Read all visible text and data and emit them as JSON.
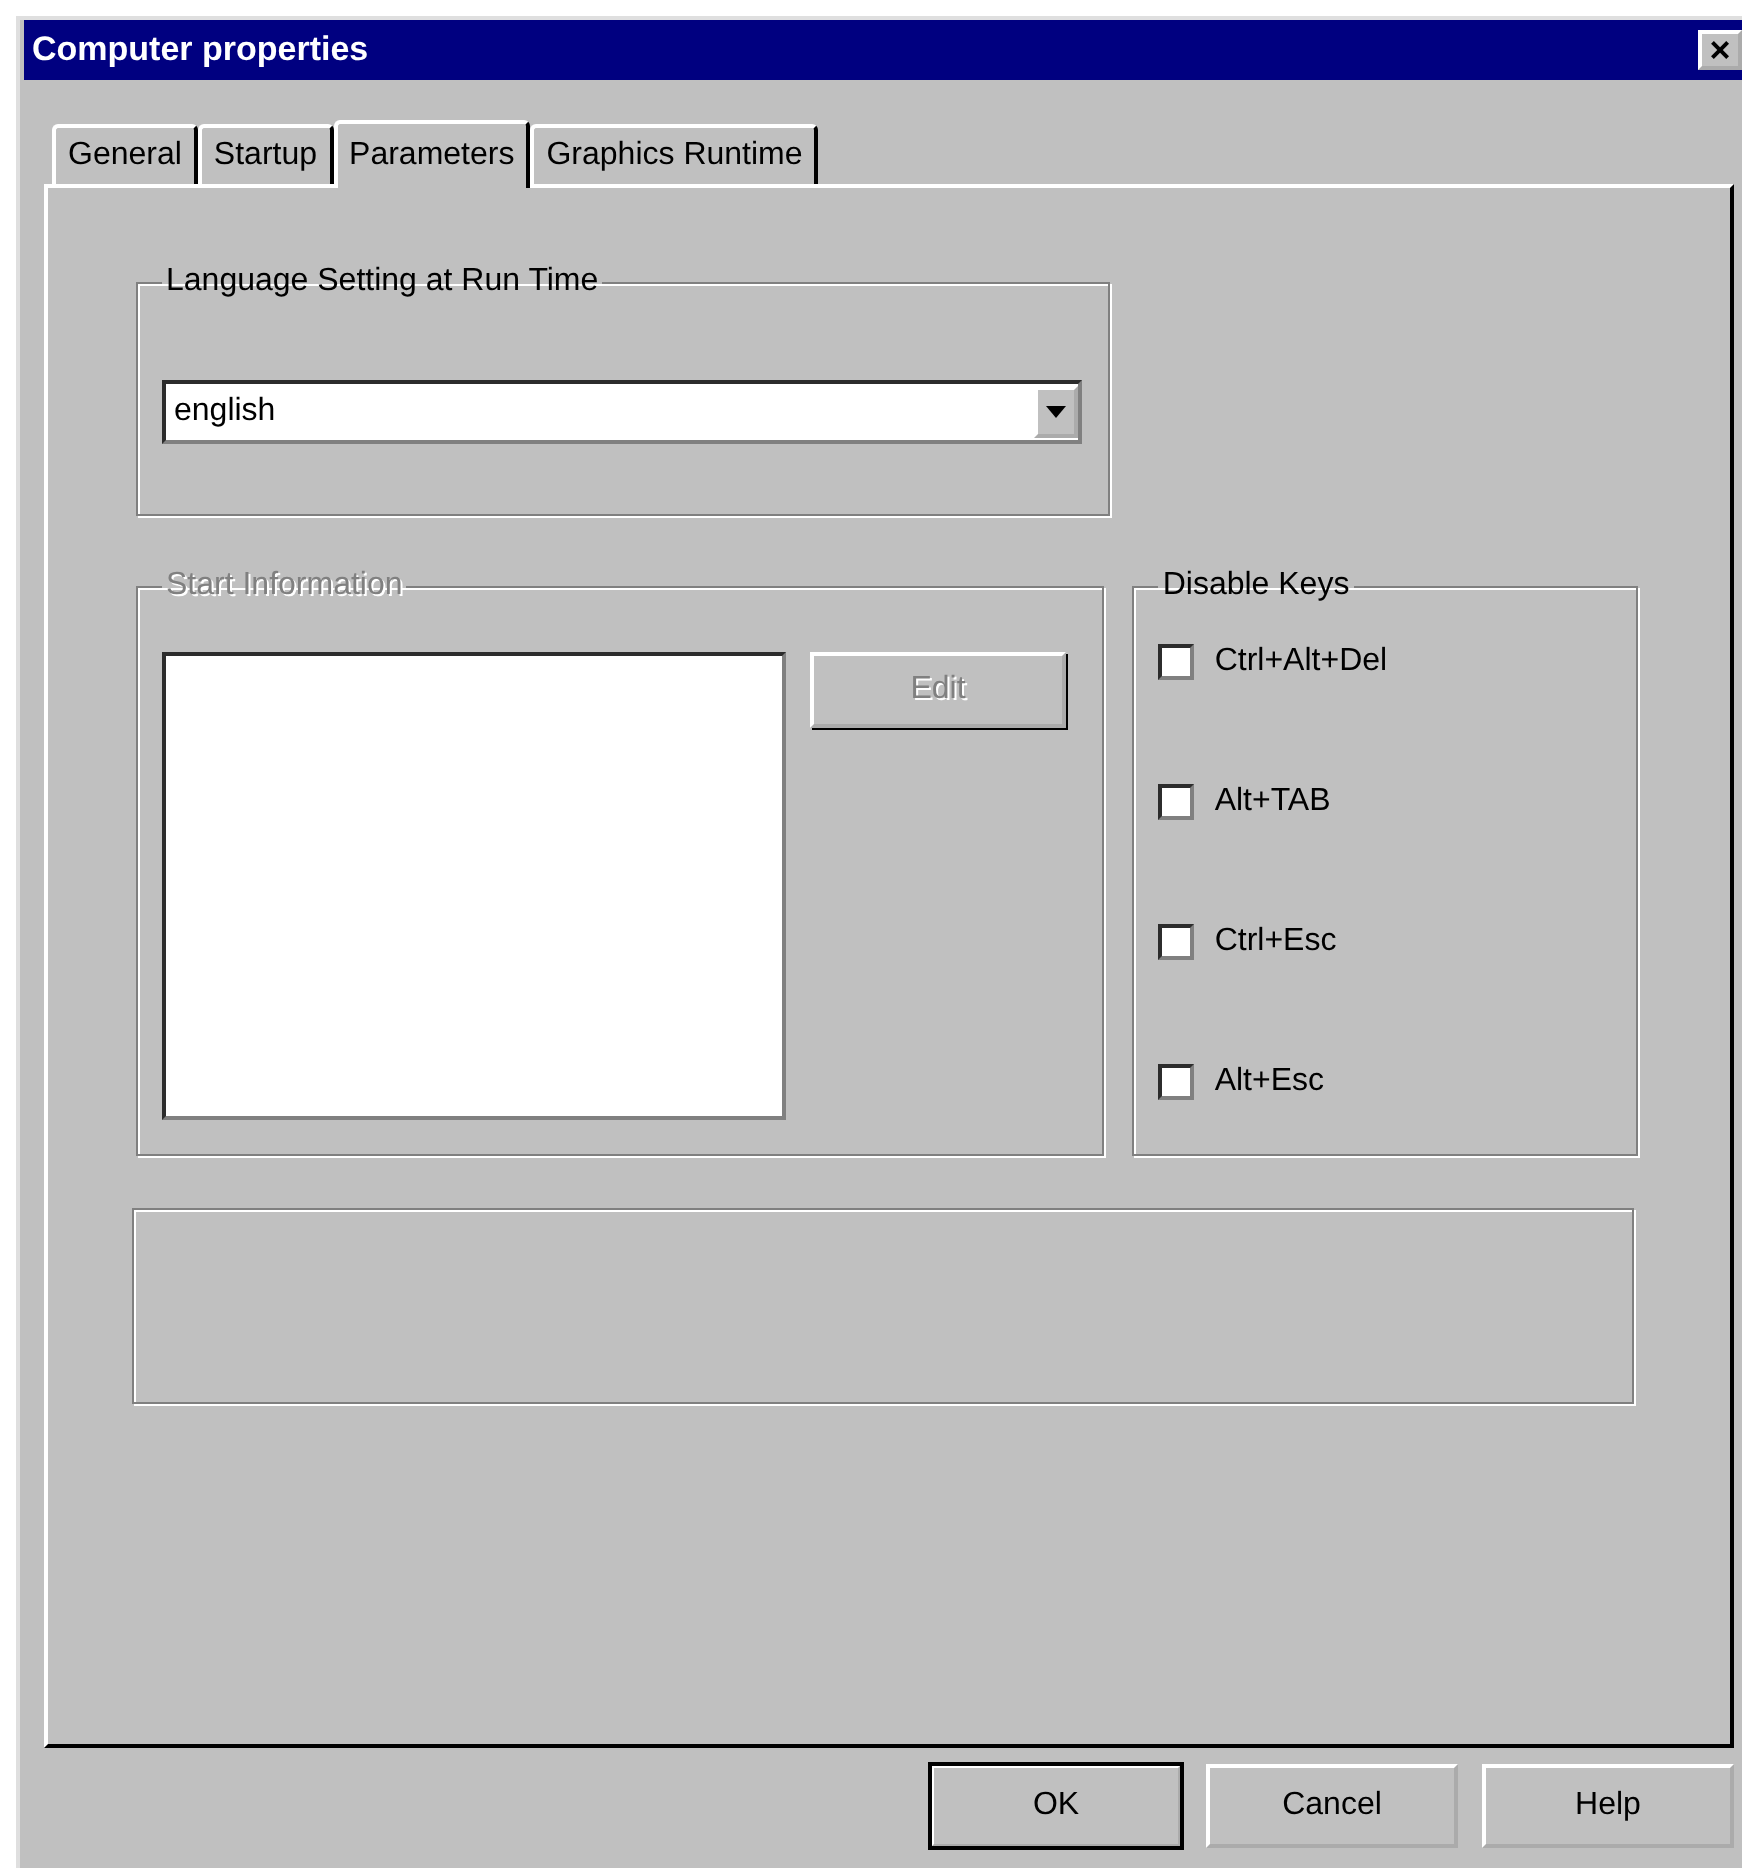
{
  "window": {
    "title": "Computer properties",
    "close": "×"
  },
  "tabs": [
    {
      "label": "General",
      "selected": false
    },
    {
      "label": "Startup",
      "selected": false
    },
    {
      "label": "Parameters",
      "selected": true
    },
    {
      "label": "Graphics Runtime",
      "selected": false
    }
  ],
  "language_group": {
    "title": "Language Setting at Run Time",
    "value": "english"
  },
  "start_information": {
    "title": "Start Information",
    "disabled": true,
    "edit_button": {
      "label": "Edit",
      "disabled": true
    }
  },
  "disable_keys": {
    "title": "Disable Keys",
    "options": [
      {
        "label": "Ctrl+Alt+Del",
        "checked": false
      },
      {
        "label": "Alt+TAB",
        "checked": false
      },
      {
        "label": "Ctrl+Esc",
        "checked": false
      },
      {
        "label": "Alt+Esc",
        "checked": false
      }
    ]
  },
  "buttons": [
    {
      "label": "OK",
      "default": true
    },
    {
      "label": "Cancel",
      "default": false
    },
    {
      "label": "Help",
      "default": false
    }
  ]
}
